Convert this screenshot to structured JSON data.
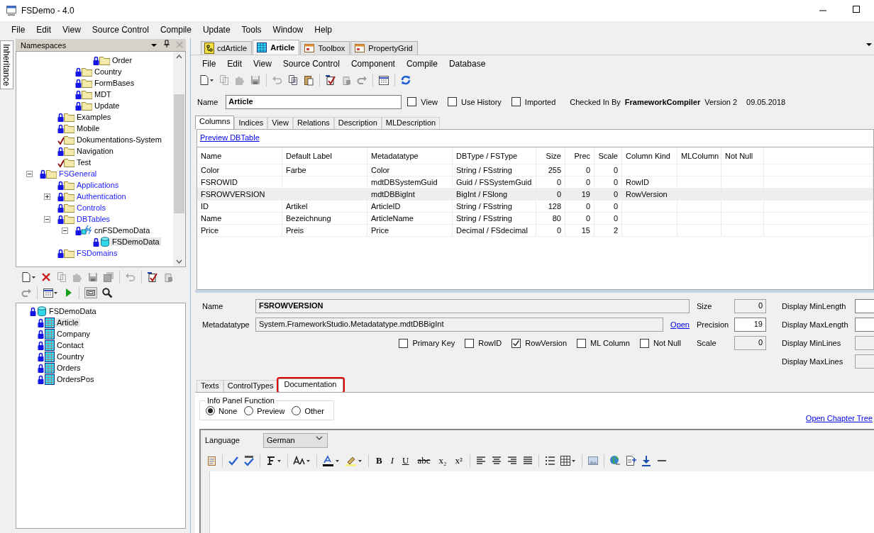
{
  "window": {
    "title": "FSDemo - 4.0"
  },
  "menu": [
    "File",
    "Edit",
    "View",
    "Source Control",
    "Compile",
    "Update",
    "Tools",
    "Window",
    "Help"
  ],
  "side_tab": {
    "label": "Inheritance"
  },
  "namespaces": {
    "title": "Namespaces",
    "items": [
      {
        "children": [
          {
            "children": [
              {
                "children": [
                  {
                    "label": "Order",
                    "kind": "locked-folder",
                    "selected": false,
                    "linked": false
                  }
                ]
              },
              {
                "label": "Country",
                "kind": "locked-folder",
                "selected": false,
                "linked": false
              },
              {
                "label": "FormBases",
                "kind": "locked-folder",
                "selected": false,
                "linked": false
              },
              {
                "label": "MDT",
                "kind": "locked-folder",
                "selected": false,
                "linked": false
              },
              {
                "label": "Update",
                "kind": "locked-folder",
                "selected": false,
                "linked": false
              }
            ]
          },
          {
            "label": "Examples",
            "kind": "locked-folder",
            "selected": false,
            "linked": false
          },
          {
            "label": "Mobile",
            "kind": "locked-folder",
            "selected": false,
            "linked": false
          },
          {
            "label": "Dokumentations-System",
            "kind": "checked-out-folder",
            "selected": false,
            "linked": false
          },
          {
            "label": "Navigation",
            "kind": "locked-folder",
            "selected": false,
            "linked": false
          },
          {
            "label": "Test",
            "kind": "checked-out-folder",
            "selected": false,
            "linked": false
          }
        ]
      },
      {
        "label": "FSGeneral",
        "kind": "locked-folder",
        "selected": false,
        "linked": true,
        "expanded": true,
        "children": [
          {
            "label": "Applications",
            "kind": "locked-folder",
            "selected": false,
            "linked": true
          },
          {
            "label": "Authentication",
            "kind": "locked-folder",
            "selected": false,
            "linked": true,
            "expanded": false
          },
          {
            "label": "Controls",
            "kind": "locked-folder",
            "selected": false,
            "linked": true
          },
          {
            "label": "DBTables",
            "kind": "locked-folder",
            "selected": false,
            "linked": true,
            "expanded": true,
            "children": [
              {
                "label": "cnFSDemoData",
                "kind": "connection",
                "selected": false,
                "linked": false,
                "expanded": true,
                "children": [
                  {
                    "label": "FSDemoData",
                    "kind": "database",
                    "selected": true,
                    "linked": false
                  }
                ]
              }
            ]
          },
          {
            "label": "FSDomains",
            "kind": "locked-folder",
            "selected": false,
            "linked": true
          }
        ]
      }
    ]
  },
  "table_tree": {
    "items": [
      {
        "label": "FSDemoData",
        "kind": "database",
        "selected": false,
        "children": [
          {
            "label": "Article",
            "kind": "table",
            "selected": true
          },
          {
            "label": "Company",
            "kind": "table",
            "selected": false
          },
          {
            "label": "Contact",
            "kind": "table",
            "selected": false
          },
          {
            "label": "Country",
            "kind": "table",
            "selected": false
          },
          {
            "label": "Orders",
            "kind": "table",
            "selected": false
          },
          {
            "label": "OrdersPos",
            "kind": "table",
            "selected": false
          }
        ]
      }
    ]
  },
  "document_tabs": [
    {
      "label": "cdArticle",
      "kind": "class",
      "selected": false
    },
    {
      "label": "Article",
      "kind": "table",
      "selected": true
    },
    {
      "label": "Toolbox",
      "kind": "form",
      "selected": false
    },
    {
      "label": "PropertyGrid",
      "kind": "form",
      "selected": false
    }
  ],
  "document_menu": [
    "File",
    "Edit",
    "View",
    "Source Control",
    "Component",
    "Compile",
    "Database"
  ],
  "name_row": {
    "label": "Name",
    "value": "Article",
    "options": [
      {
        "label": "View",
        "checked": false
      },
      {
        "label": "Use History",
        "checked": false
      },
      {
        "label": "Imported",
        "checked": false
      }
    ],
    "checked_in_label": "Checked In By",
    "checked_in_by": "FrameworkCompiler",
    "version": "Version 2",
    "date": "09.05.2018"
  },
  "section_tabs": [
    {
      "label": "Columns",
      "selected": true
    },
    {
      "label": "Indices",
      "selected": false
    },
    {
      "label": "View",
      "selected": false
    },
    {
      "label": "Relations",
      "selected": false
    },
    {
      "label": "Description",
      "selected": false
    },
    {
      "label": "MLDescription",
      "selected": false
    }
  ],
  "preview_link": "Preview DBTable",
  "table": {
    "columns": [
      {
        "label": "Name",
        "kind": "text"
      },
      {
        "label": "Default Label",
        "kind": "text"
      },
      {
        "label": "Metadatatype",
        "kind": "text"
      },
      {
        "label": "DBType / FSType",
        "kind": "text"
      },
      {
        "label": "Size",
        "kind": "number"
      },
      {
        "label": "Prec",
        "kind": "number"
      },
      {
        "label": "Scale",
        "kind": "number"
      },
      {
        "label": "Column Kind",
        "kind": "text"
      },
      {
        "label": "MLColumn",
        "kind": "text"
      },
      {
        "label": "Not Null",
        "kind": "text"
      }
    ],
    "rows": [
      {
        "selected": false,
        "cells": [
          "Color",
          "Farbe",
          "Color",
          "String / FSstring",
          "255",
          "0",
          "0"
        ]
      },
      {
        "selected": false,
        "cells": [
          "FSROWID",
          null,
          "mdtDBSystemGuid",
          "Guid / FSSystemGuid",
          "0",
          "0",
          "0",
          "RowID"
        ]
      },
      {
        "selected": true,
        "cells": [
          "FSROWVERSION",
          null,
          "mdtDBBigInt",
          "BigInt / FSlong",
          "0",
          "19",
          "0",
          "RowVersion"
        ]
      },
      {
        "selected": false,
        "cells": [
          "ID",
          "Artikel",
          "ArticleID",
          "String / FSstring",
          "128",
          "0",
          "0"
        ]
      },
      {
        "selected": false,
        "cells": [
          "Name",
          "Bezeichnung",
          "ArticleName",
          "String / FSstring",
          "80",
          "0",
          "0"
        ]
      },
      {
        "selected": false,
        "cells": [
          "Price",
          "Preis",
          "Price",
          "Decimal / FSdecimal",
          "0",
          "15",
          "2"
        ]
      }
    ]
  },
  "column_details": {
    "name": {
      "label": "Name",
      "value": "FSROWVERSION"
    },
    "metadatatype": {
      "label": "Metadatatype",
      "value": "System.FrameworkStudio.Metadatatype.mdtDBBigInt",
      "link": "Open"
    },
    "numbers": [
      {
        "label": "Size",
        "value": "0",
        "disabled": true
      },
      {
        "label": "Precision",
        "value": "19",
        "disabled": false
      },
      {
        "label": "Scale",
        "value": "0",
        "disabled": true
      }
    ],
    "flags": [
      {
        "label": "Primary Key",
        "checked": false
      },
      {
        "label": "RowID",
        "checked": false
      },
      {
        "label": "RowVersion",
        "checked": true
      },
      {
        "label": "ML Column",
        "checked": false
      },
      {
        "label": "Not Null",
        "checked": false
      }
    ],
    "display": [
      {
        "label": "Display MinLength",
        "disabled": false
      },
      {
        "label": "Display MaxLength",
        "disabled": false
      },
      {
        "label": "Display MinLines",
        "disabled": true
      },
      {
        "label": "Display MaxLines",
        "disabled": true
      }
    ]
  },
  "detail_tabs": [
    {
      "label": "Texts",
      "selected": false,
      "outlined": false
    },
    {
      "label": "ControlTypes",
      "selected": false,
      "outlined": false
    },
    {
      "label": "Documentation",
      "selected": true,
      "outlined": true
    }
  ],
  "info_panel": {
    "title": "Info Panel Function",
    "options": [
      {
        "label": "None",
        "selected": true
      },
      {
        "label": "Preview",
        "selected": false
      },
      {
        "label": "Other",
        "selected": false
      }
    ]
  },
  "chapter_link": "Open Chapter Tree",
  "editor": {
    "language_label": "Language",
    "language": "German",
    "format_buttons": [
      {
        "label": "B",
        "kind": "bold"
      },
      {
        "label": "I",
        "kind": "italic"
      },
      {
        "label": "U",
        "kind": "underline"
      },
      {
        "label": "abc",
        "kind": "strike"
      },
      {
        "label": "x₂",
        "kind": "subscript"
      },
      {
        "label": "x²",
        "kind": "superscript"
      }
    ]
  }
}
